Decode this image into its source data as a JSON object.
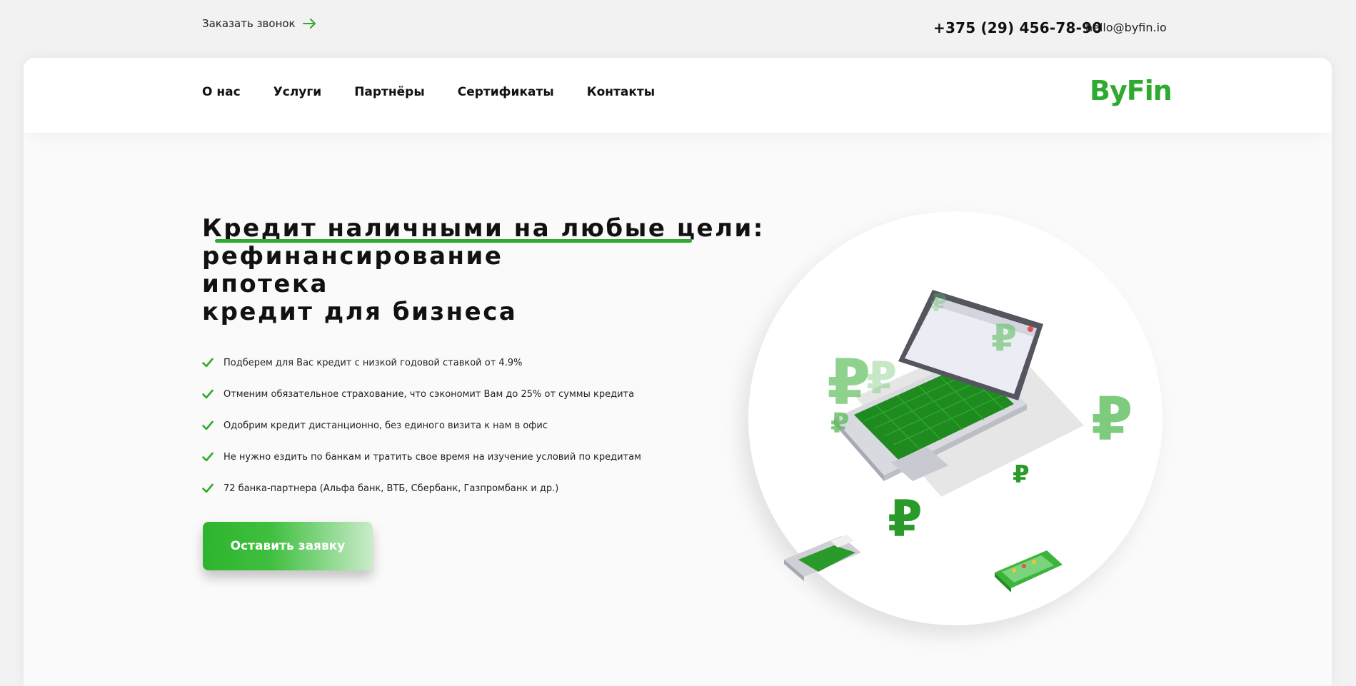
{
  "topbar": {
    "callback_label": "Заказать звонок",
    "phone": "+375 (29) 456-78-90",
    "email": "hello@byfin.io"
  },
  "nav": {
    "items": [
      {
        "label": "О нас"
      },
      {
        "label": "Услуги"
      },
      {
        "label": "Партнёры"
      },
      {
        "label": "Сертификаты"
      },
      {
        "label": "Контакты"
      }
    ],
    "logo": "ByFin"
  },
  "hero": {
    "title_lines": [
      "Кредит наличными на любые цели:",
      "рефинансирование",
      "ипотека",
      "кредит для бизнеса"
    ],
    "features": [
      "Подберем для Вас кредит с низкой годовой ставкой от 4.9%",
      "Отменим обязательное страхование, что сэкономит Вам до 25% от суммы кредита",
      "Одобрим кредит дистанционно, без единого визита к нам в офис",
      "Не нужно ездить по банкам и тратить свое время на изучение условий по кредитам",
      "72 банка-партнера (Альфа банк, ВТБ, Сбербанк, Газпромбанк и др.)"
    ],
    "cta_label": "Оставить заявку"
  },
  "colors": {
    "brand": "#2eaa2e",
    "background": "#f2f2f2",
    "card": "#fafafa"
  },
  "icons": {
    "callback_arrow": "arrow-right-icon",
    "feature_check": "checkmark-icon"
  }
}
